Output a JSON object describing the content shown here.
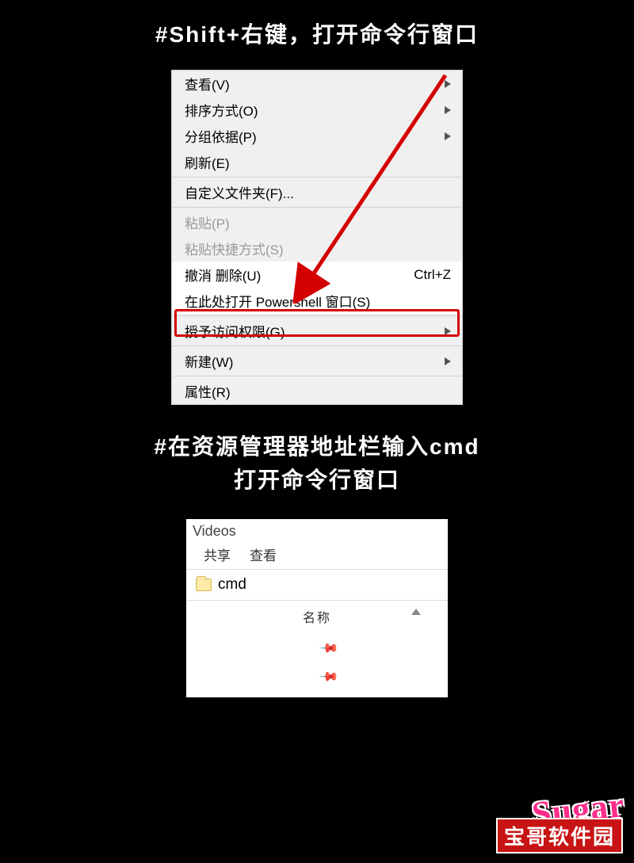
{
  "headings": {
    "h1": "#Shift+右键，打开命令行窗口",
    "h2a": "#在资源管理器地址栏输入cmd",
    "h2b": "打开命令行窗口"
  },
  "context_menu": {
    "items": {
      "view": "查看(V)",
      "sort": "排序方式(O)",
      "group": "分组依据(P)",
      "refresh": "刷新(E)",
      "custom_folder": "自定义文件夹(F)...",
      "paste": "粘贴(P)",
      "paste_shortcut": "粘贴快捷方式(S)",
      "undo_delete": "撤消 删除(U)",
      "undo_shortcut": "Ctrl+Z",
      "powershell": "在此处打开 Powershell 窗口(S)",
      "grant_access": "授予访问权限(G)",
      "new": "新建(W)",
      "properties": "属性(R)"
    }
  },
  "explorer": {
    "title": "Videos",
    "tabs": {
      "share": "共享",
      "view": "查看"
    },
    "address": "cmd",
    "column": "名称"
  },
  "watermark": {
    "logo": "Sugar",
    "text": "宝哥软件园"
  }
}
